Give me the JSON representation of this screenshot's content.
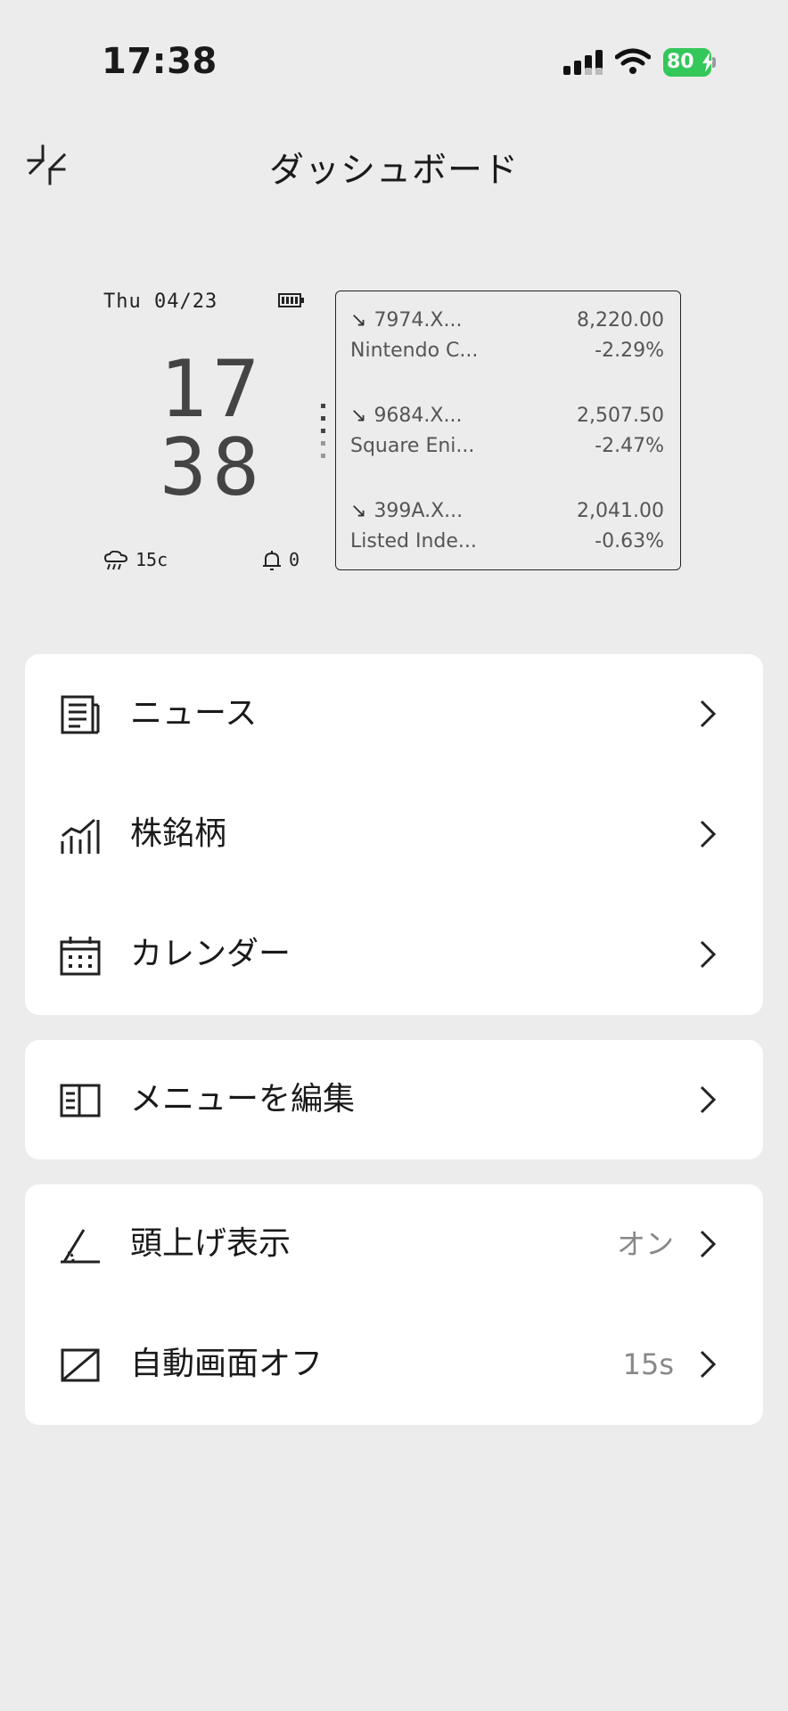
{
  "status_bar": {
    "time": "17:38",
    "battery": "80"
  },
  "header": {
    "title": "ダッシュボード",
    "icon": "collapse-icon"
  },
  "widget": {
    "date": "Thu 04/23",
    "clock_hour": "17",
    "clock_minute": "38",
    "temperature": "15c",
    "notifications": "0",
    "stocks": [
      {
        "symbol": "7974.X...",
        "name": "Nintendo C...",
        "price": "8,220.00",
        "change": "-2.29%"
      },
      {
        "symbol": "9684.X...",
        "name": "Square Eni...",
        "price": "2,507.50",
        "change": "-2.47%"
      },
      {
        "symbol": "399A.X...",
        "name": "Listed Inde...",
        "price": "2,041.00",
        "change": "-0.63%"
      }
    ]
  },
  "menu_primary": [
    {
      "label": "ニュース",
      "icon": "newspaper-icon"
    },
    {
      "label": "株銘柄",
      "icon": "stock-chart-icon"
    },
    {
      "label": "カレンダー",
      "icon": "calendar-icon"
    }
  ],
  "menu_edit": {
    "label": "メニューを編集",
    "icon": "edit-menu-icon"
  },
  "menu_settings": [
    {
      "label": "頭上げ表示",
      "value": "オン",
      "icon": "raise-to-wake-icon"
    },
    {
      "label": "自動画面オフ",
      "value": "15s",
      "icon": "screen-off-icon"
    }
  ]
}
